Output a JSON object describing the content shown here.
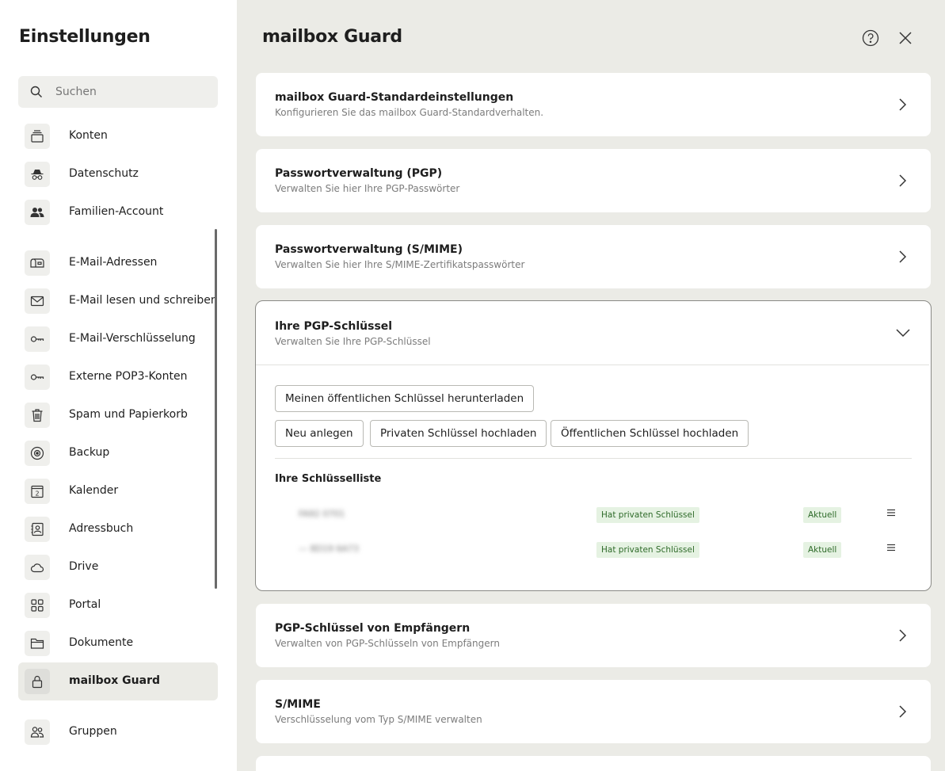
{
  "sidebar": {
    "title": "Einstellungen",
    "search_placeholder": "Suchen",
    "items": [
      {
        "label": "Konten",
        "icon": "stack-icon"
      },
      {
        "label": "Datenschutz",
        "icon": "incognito-icon"
      },
      {
        "label": "Familien-Account",
        "icon": "people-icon"
      },
      {
        "label": "E-Mail-Adressen",
        "icon": "mailbox-icon"
      },
      {
        "label": "E-Mail lesen und schreiben",
        "icon": "envelope-icon"
      },
      {
        "label": "E-Mail-Verschlüsselung",
        "icon": "key-icon"
      },
      {
        "label": "Externe POP3-Konten",
        "icon": "key-icon"
      },
      {
        "label": "Spam und Papierkorb",
        "icon": "trash-icon"
      },
      {
        "label": "Backup",
        "icon": "backup-icon"
      },
      {
        "label": "Kalender",
        "icon": "calendar-icon"
      },
      {
        "label": "Adressbuch",
        "icon": "addressbook-icon"
      },
      {
        "label": "Drive",
        "icon": "cloud-icon"
      },
      {
        "label": "Portal",
        "icon": "grid-icon"
      },
      {
        "label": "Dokumente",
        "icon": "folder-icon"
      },
      {
        "label": "mailbox Guard",
        "icon": "lock-icon"
      },
      {
        "label": "Gruppen",
        "icon": "group-icon"
      }
    ],
    "calendar_day": "2"
  },
  "main": {
    "title": "mailbox Guard",
    "cards": [
      {
        "title": "mailbox Guard-Standardeinstellungen",
        "subtitle": "Konfigurieren Sie das mailbox Guard-Standardverhalten."
      },
      {
        "title": "Passwortverwaltung (PGP)",
        "subtitle": "Verwalten Sie hier Ihre PGP-Passwörter"
      },
      {
        "title": "Passwortverwaltung (S/MIME)",
        "subtitle": "Verwalten Sie hier Ihre S/MIME-Zertifikatspasswörter"
      },
      {
        "title": "Ihre PGP-Schlüssel",
        "subtitle": "Verwalten Sie Ihre PGP-Schlüssel"
      },
      {
        "title": "PGP-Schlüssel von Empfängern",
        "subtitle": "Verwalten von PGP-Schlüsseln von Empfängern"
      },
      {
        "title": "S/MIME",
        "subtitle": "Verschlüsselung vom Typ S/MIME verwalten"
      }
    ],
    "pgp": {
      "download_public": "Meinen öffentlichen Schlüssel herunterladen",
      "create_new": "Neu anlegen",
      "upload_private": "Privaten Schlüssel hochladen",
      "upload_public": "Öffentlichen Schlüssel hochladen",
      "list_title": "Ihre Schlüsselliste",
      "keys": [
        {
          "name": "FA92 0701",
          "private_badge": "Hat privaten Schlüssel",
          "status": "Aktuell"
        },
        {
          "name": "— 8D19 6A73",
          "private_badge": "Hat privaten Schlüssel",
          "status": "Aktuell"
        }
      ]
    }
  },
  "colors": {
    "background": "#ebebe6",
    "panel": "#ffffff",
    "badge_bg": "#e5f2e2",
    "badge_text": "#2f6b2a"
  }
}
